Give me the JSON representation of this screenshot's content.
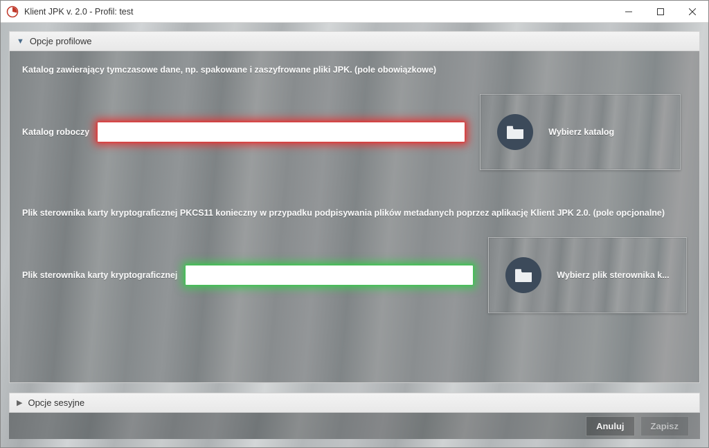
{
  "window": {
    "title": "Klient JPK v. 2.0 - Profil: test"
  },
  "sections": {
    "profile": {
      "header": "Opcje profilowe",
      "group1": {
        "desc": "Katalog zawierający tymczasowe dane, np. spakowane i zaszyfrowane pliki JPK. (pole obowiązkowe)",
        "label": "Katalog roboczy",
        "value": "",
        "button": "Wybierz katalog"
      },
      "group2": {
        "desc": "Plik sterownika karty kryptograficznej PKCS11 konieczny w przypadku podpisywania plików metadanych poprzez aplikację Klient JPK 2.0. (pole opcjonalne)",
        "label": "Plik sterownika karty kryptograficznej",
        "value": "",
        "button": "Wybierz plik sterownika k..."
      }
    },
    "session": {
      "header": "Opcje sesyjne"
    }
  },
  "footer": {
    "cancel": "Anuluj",
    "save": "Zapisz"
  },
  "colors": {
    "folder_icon_bg": "#3c4a5a",
    "folder_icon_fg": "#f0f0f0"
  }
}
